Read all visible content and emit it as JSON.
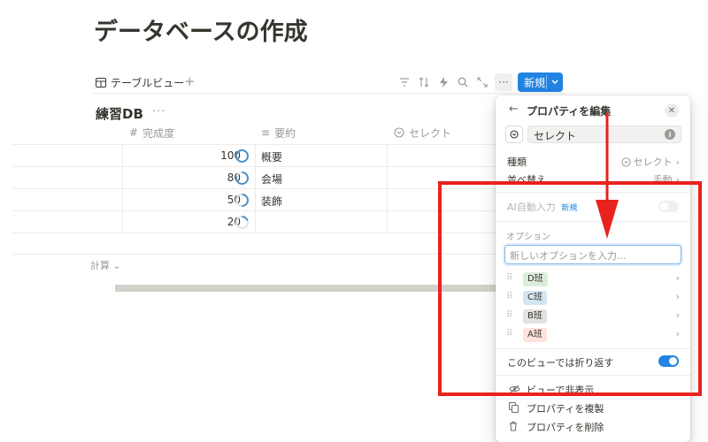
{
  "page": {
    "title": "データベースの作成"
  },
  "view": {
    "tab_label": "テーブルビュー",
    "add": "+",
    "new_button": "新規"
  },
  "database": {
    "title": "練習DB",
    "more": "···"
  },
  "table": {
    "columns": [
      {
        "icon": "#",
        "label": "完成度"
      },
      {
        "icon": "≡",
        "label": "要約"
      },
      {
        "icon": "select-icon",
        "label": "セレクト"
      }
    ],
    "rows": [
      {
        "progress": "100",
        "progress_fraction": 1.0,
        "summary": "概要"
      },
      {
        "progress": "80",
        "progress_fraction": 0.8,
        "summary": "会場"
      },
      {
        "progress": "50",
        "progress_fraction": 0.5,
        "summary": "装飾"
      },
      {
        "progress": "20",
        "progress_fraction": 0.2,
        "summary": ""
      }
    ],
    "calc_label": "計算 ⌄"
  },
  "panel": {
    "title": "プロパティを編集",
    "name_value": "セレクト",
    "type_label": "種類",
    "type_value": "セレクト",
    "sort_label": "並べ替え",
    "sort_value": "手動",
    "ai_label": "AI自動入力",
    "ai_badge": "新規",
    "options_section": "オプション",
    "option_placeholder": "新しいオプションを入力...",
    "options": [
      {
        "label": "D班",
        "color": "#dbeddb"
      },
      {
        "label": "C班",
        "color": "#d3e5ef"
      },
      {
        "label": "B班",
        "color": "#e3e2e0"
      },
      {
        "label": "A班",
        "color": "#ffe2dd"
      }
    ],
    "wrap_label": "このビューでは折り返す",
    "wrap_on": true,
    "hide_label": "ビューで非表示",
    "duplicate_label": "プロパティを複製",
    "delete_label": "プロパティを削除"
  },
  "colors": {
    "accent": "#2383e2",
    "highlight": "#e8221e",
    "progress_ring": "#4a90c8"
  }
}
